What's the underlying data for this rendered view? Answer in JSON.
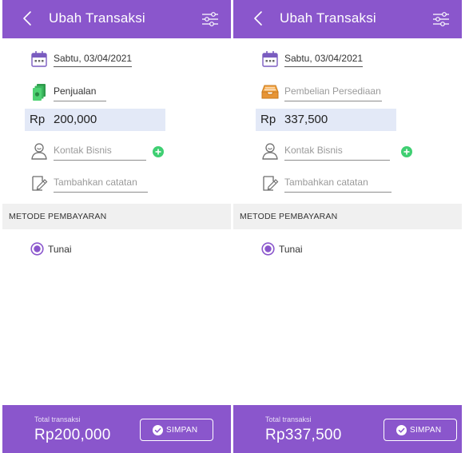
{
  "screens": [
    {
      "app_bar": {
        "title": "Ubah Transaksi",
        "back_icon": "chevron-left-icon",
        "filter_icon": "sliders-icon"
      },
      "date": {
        "value": "Sabtu, 03/04/2021",
        "icon": "calendar-icon"
      },
      "category": {
        "value": "Penjualan",
        "icon": "money-stack-icon",
        "is_placeholder": false
      },
      "amount": {
        "prefix": "Rp",
        "value": "200,000"
      },
      "contact": {
        "placeholder": "Kontak Bisnis",
        "icon": "person-icon",
        "add_icon": "plus-circle-icon"
      },
      "note": {
        "placeholder": "Tambahkan catatan",
        "icon": "edit-note-icon"
      },
      "payment": {
        "section_label": "METODE PEMBAYARAN",
        "option": "Tunai",
        "selected": true
      },
      "footer": {
        "total_label": "Total transaksi",
        "total_value": "Rp200,000",
        "save_label": "SIMPAN",
        "save_icon": "check-circle-icon"
      }
    },
    {
      "app_bar": {
        "title": "Ubah Transaksi",
        "back_icon": "chevron-left-icon",
        "filter_icon": "sliders-icon"
      },
      "date": {
        "value": "Sabtu, 03/04/2021",
        "icon": "calendar-icon"
      },
      "category": {
        "value": "Pembelian Persediaan",
        "icon": "inbox-tray-icon",
        "is_placeholder": true
      },
      "amount": {
        "prefix": "Rp",
        "value": "337,500"
      },
      "contact": {
        "placeholder": "Kontak Bisnis",
        "icon": "person-icon",
        "add_icon": "plus-circle-icon"
      },
      "note": {
        "placeholder": "Tambahkan catatan",
        "icon": "edit-note-icon"
      },
      "payment": {
        "section_label": "METODE PEMBAYARAN",
        "option": "Tunai",
        "selected": true
      },
      "footer": {
        "total_label": "Total transaksi",
        "total_value": "Rp337,500",
        "save_label": "SIMPAN",
        "save_icon": "check-circle-icon"
      }
    }
  ],
  "colors": {
    "primary": "#8a56cc",
    "accent_green": "#3fcf72",
    "amount_bg": "#e3e9f7",
    "section_bg": "#f0f0f0"
  }
}
